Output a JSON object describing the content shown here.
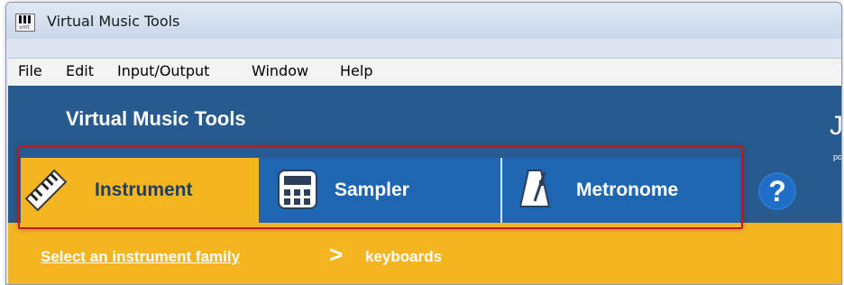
{
  "window": {
    "title": "Virtual Music Tools",
    "icon_caption": "vmt",
    "icon": "piano-keys-icon"
  },
  "menubar": {
    "items": [
      "File",
      "Edit",
      "Input/Output",
      "Window",
      "Help"
    ]
  },
  "header": {
    "app_title": "Virtual Music Tools",
    "brand_letter": "J",
    "brand_small": "po"
  },
  "tabs": [
    {
      "label": "Instrument",
      "icon": "keyboard-icon",
      "active": true
    },
    {
      "label": "Sampler",
      "icon": "sampler-pad-icon",
      "active": false
    },
    {
      "label": "Metronome",
      "icon": "metronome-icon",
      "active": false
    }
  ],
  "help": {
    "label": "?"
  },
  "breadcrumb": {
    "link": "Select an instrument family",
    "separator": ">",
    "current": "keyboards"
  },
  "colors": {
    "header_blue": "#275a8e",
    "tab_blue": "#1f66b2",
    "accent_yellow": "#f5b521",
    "highlight_red": "#c0191e"
  }
}
